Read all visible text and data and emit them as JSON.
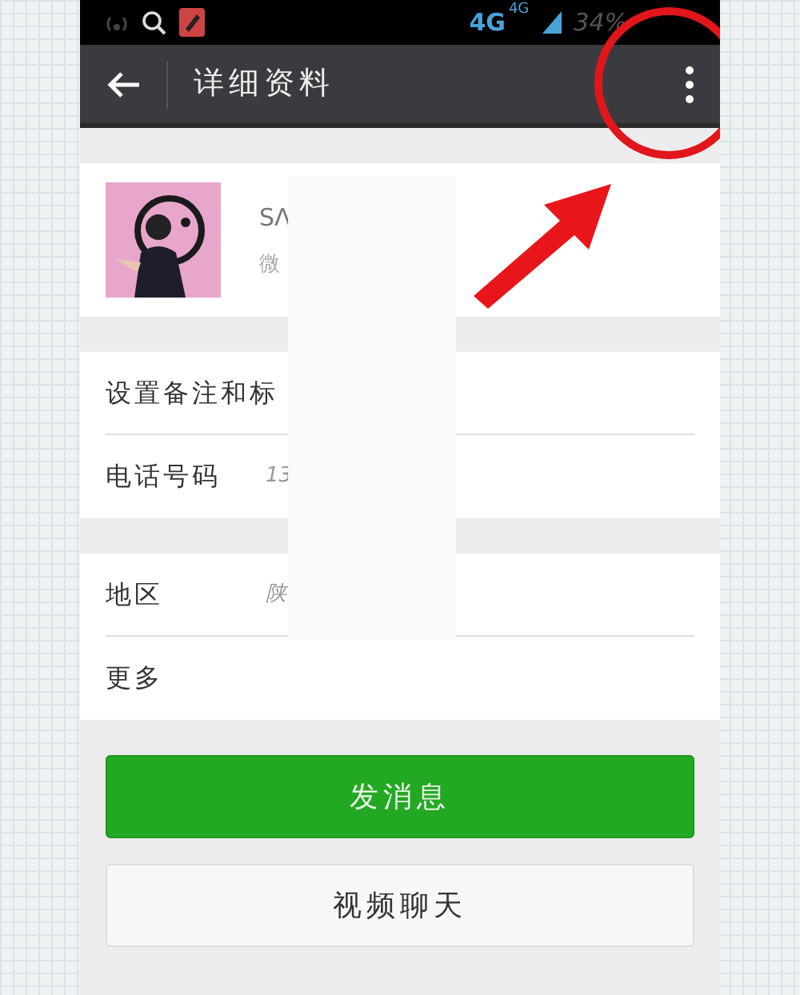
{
  "status_bar": {
    "network": "4G",
    "network_small": "4G",
    "battery": "34%"
  },
  "app_bar": {
    "title": "详细资料"
  },
  "profile": {
    "name": "SΛ",
    "account": "微"
  },
  "groups": [
    [
      {
        "label": "设置备注和标"
      },
      {
        "label": "电话号码",
        "value": "13"
      }
    ],
    [
      {
        "label": "地区",
        "value": "陕"
      },
      {
        "label": "更多"
      }
    ]
  ],
  "buttons": [
    {
      "label": "发消息",
      "kind": "primary"
    },
    {
      "label": "视频聊天",
      "kind": "secondary"
    }
  ]
}
